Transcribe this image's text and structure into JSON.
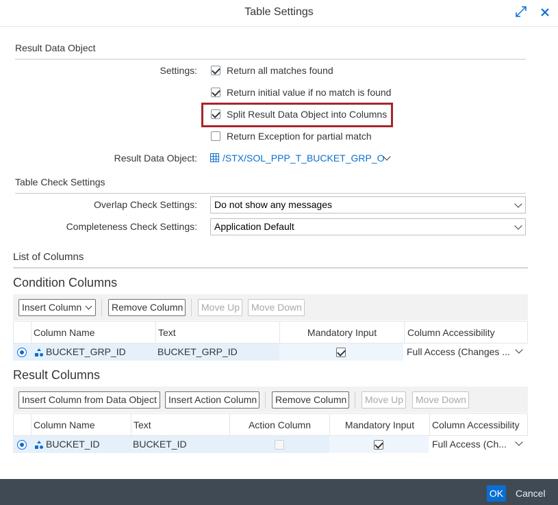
{
  "dialog": {
    "title": "Table Settings",
    "expand_icon": "expand-icon",
    "close_icon": "close-icon"
  },
  "result_data_object_section": {
    "title": "Result Data Object",
    "settings_label": "Settings:",
    "options": [
      {
        "label": "Return all matches found",
        "checked": true
      },
      {
        "label": "Return initial value if no match is found",
        "checked": true
      },
      {
        "label": "Split Result Data Object into Columns",
        "checked": true,
        "highlighted": true
      },
      {
        "label": "Return Exception for partial match",
        "checked": false
      }
    ],
    "result_object_label": "Result Data Object:",
    "result_object_value": "/STX/SOL_PPP_T_BUCKET_GRP_O"
  },
  "table_check_section": {
    "title": "Table Check Settings",
    "overlap_label": "Overlap Check Settings:",
    "overlap_value": "Do not show any messages",
    "completeness_label": "Completeness Check Settings:",
    "completeness_value": "Application Default"
  },
  "list_of_columns": {
    "title": "List of Columns"
  },
  "condition_columns": {
    "title": "Condition Columns",
    "toolbar": {
      "insert_column": "Insert Column",
      "remove_column": "Remove Column",
      "move_up": "Move Up",
      "move_down": "Move Down"
    },
    "headers": [
      "Column Name",
      "Text",
      "Mandatory Input",
      "Column Accessibility"
    ],
    "rows": [
      {
        "name": "BUCKET_GRP_ID",
        "text": "BUCKET_GRP_ID",
        "mandatory": true,
        "accessibility": "Full Access (Changes ..."
      }
    ]
  },
  "result_columns": {
    "title": "Result Columns",
    "toolbar": {
      "insert_from_data_object": "Insert Column from Data Object",
      "insert_action_column": "Insert Action Column",
      "remove_column": "Remove Column",
      "move_up": "Move Up",
      "move_down": "Move Down"
    },
    "headers": [
      "Column Name",
      "Text",
      "Action Column",
      "Mandatory Input",
      "Column Accessibility"
    ],
    "rows": [
      {
        "name": "BUCKET_ID",
        "text": "BUCKET_ID",
        "action": false,
        "mandatory": true,
        "accessibility": "Full Access (Ch..."
      }
    ]
  },
  "footer": {
    "ok": "OK",
    "cancel": "Cancel"
  },
  "colors": {
    "accent": "#0a6ed1",
    "highlight_border": "#a4262c",
    "footer_bg": "#3f4a55",
    "selected_row": "#e5f0fa"
  }
}
